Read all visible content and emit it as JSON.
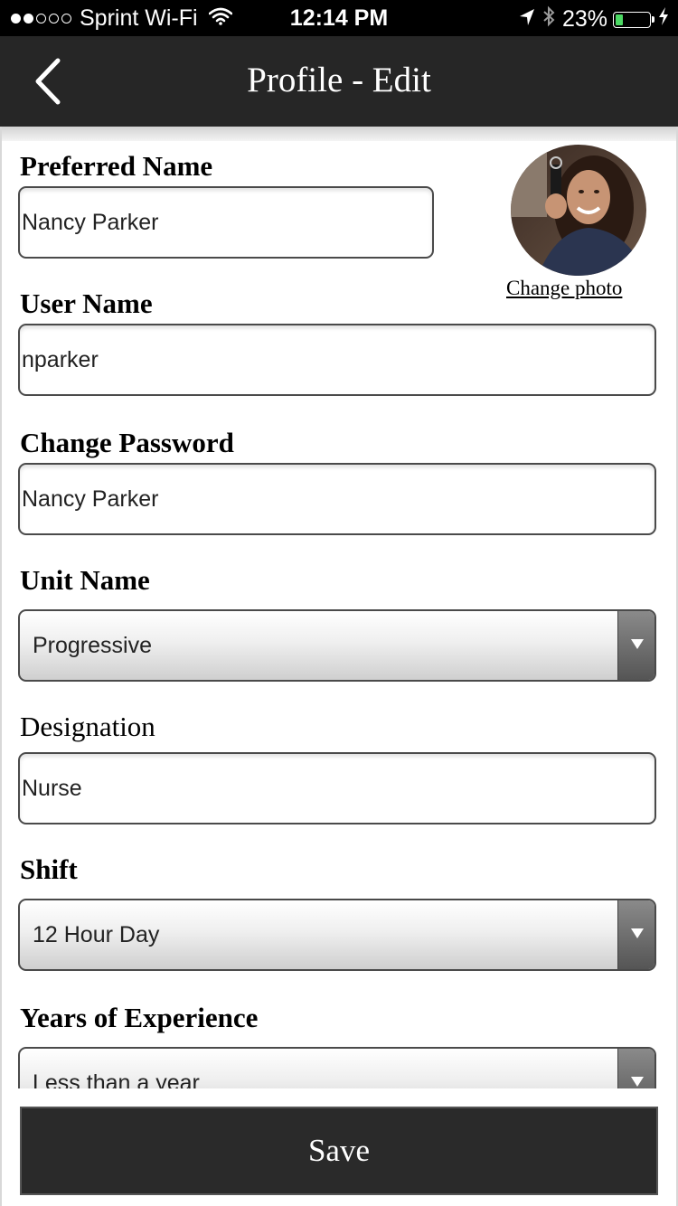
{
  "status_bar": {
    "carrier": "Sprint Wi-Fi",
    "time": "12:14 PM",
    "battery_percent_text": "23%",
    "battery_level": 0.23,
    "icons": [
      "signal-dots-icon",
      "wifi-icon",
      "location-arrow-icon",
      "bluetooth-icon",
      "battery-icon",
      "charging-bolt-icon"
    ]
  },
  "header": {
    "title": "Profile - Edit",
    "back_icon": "chevron-left-icon"
  },
  "profile_photo": {
    "change_photo_label": "Change photo"
  },
  "form": {
    "preferred_name": {
      "label": "Preferred Name",
      "value": "Nancy Parker"
    },
    "user_name": {
      "label": "User Name",
      "value": "nparker"
    },
    "change_password": {
      "label": "Change Password",
      "value": "Nancy Parker"
    },
    "unit_name": {
      "label": "Unit Name",
      "value": "Progressive"
    },
    "designation": {
      "label": "Designation",
      "value": "Nurse"
    },
    "shift": {
      "label": "Shift",
      "value": "12 Hour Day"
    },
    "years_of_experience": {
      "label": "Years of Experience",
      "value": "Less than a year"
    }
  },
  "actions": {
    "save_label": "Save"
  },
  "colors": {
    "status_bar_bg": "#000000",
    "nav_bar_bg": "#262626",
    "save_button_bg": "#2a2a2a",
    "battery_green": "#4cd964"
  }
}
